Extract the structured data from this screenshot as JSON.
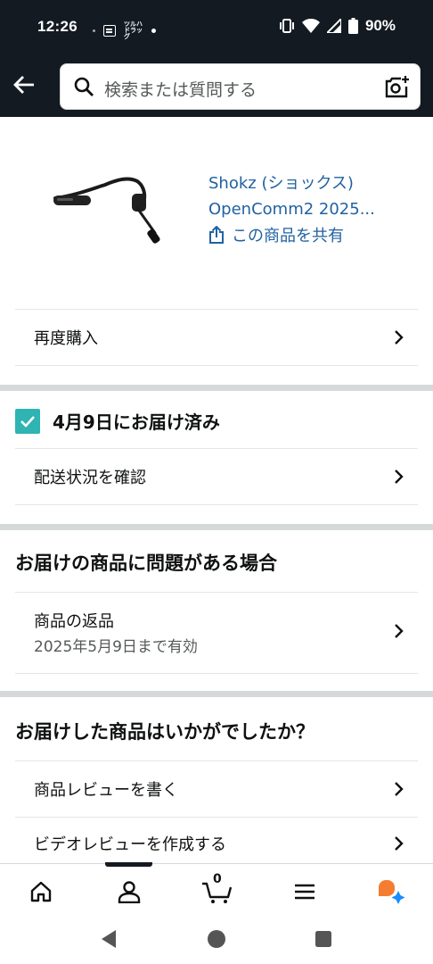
{
  "status_bar": {
    "time": "12:26",
    "app_badge": "ツルハ ドラッグ",
    "battery": "90%"
  },
  "search": {
    "placeholder": "検索または質問する"
  },
  "product": {
    "title_line1": "Shokz (ショックス)",
    "title_line2": "OpenComm2 2025...",
    "share_label": "この商品を共有"
  },
  "actions": {
    "buy_again": "再度購入"
  },
  "delivery": {
    "status": "4月9日にお届け済み",
    "track_label": "配送状況を確認"
  },
  "problem_section": {
    "title": "お届けの商品に問題がある場合",
    "return_label": "商品の返品",
    "return_deadline": "2025年5月9日まで有効"
  },
  "feedback_section": {
    "title": "お届けした商品はいかがでしたか？",
    "write_review": "商品レビューを書く",
    "video_review": "ビデオレビューを作成する"
  },
  "bottom_nav": {
    "items": [
      "home-icon",
      "account-icon",
      "cart-icon",
      "menu-icon",
      "rufus-icon"
    ],
    "cart_count": "0",
    "active": "account-icon"
  },
  "colors": {
    "header_bg": "#131a22",
    "link": "#2162a1",
    "check": "#2fb3b3",
    "rufus_orange": "#f47d31",
    "rufus_blue": "#1a8cff"
  }
}
